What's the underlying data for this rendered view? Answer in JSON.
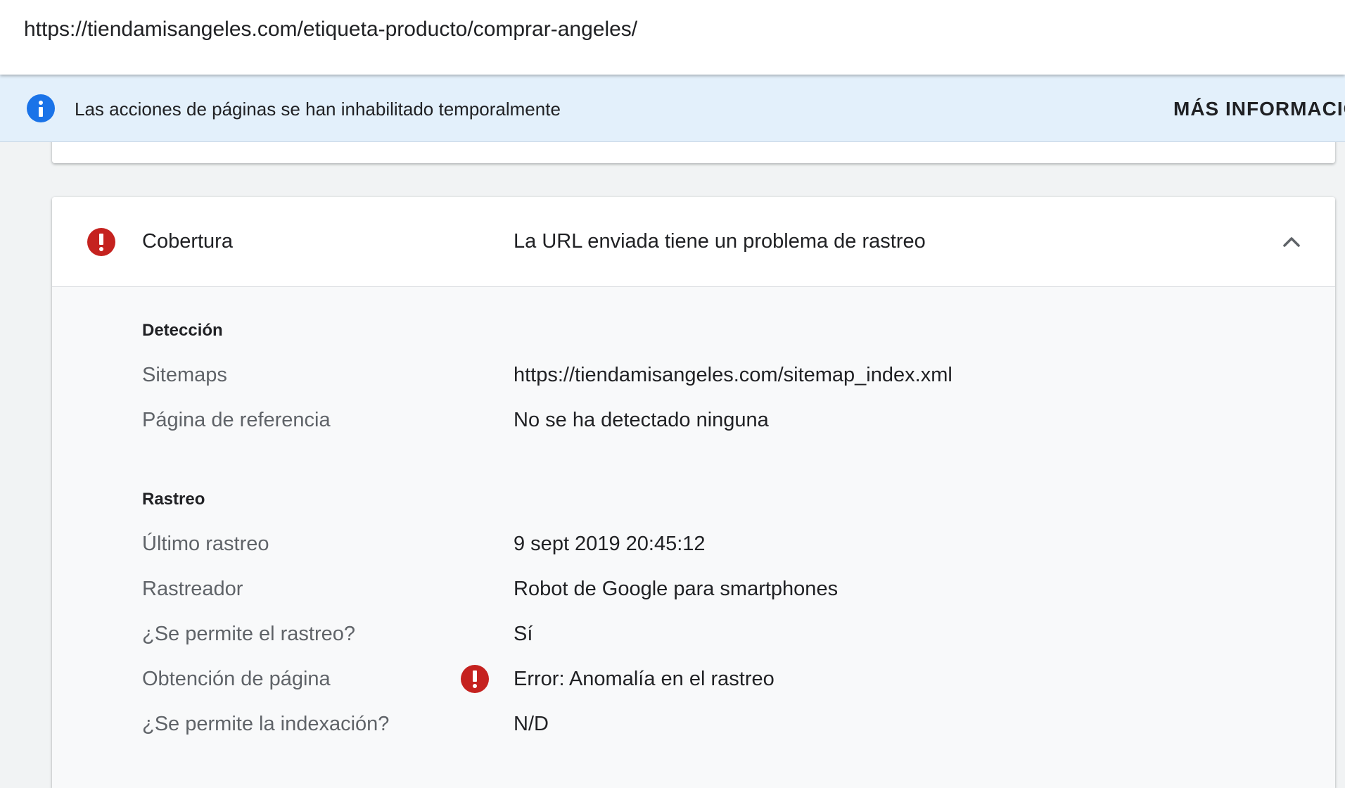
{
  "url_bar": {
    "url": "https://tiendamisangeles.com/etiqueta-producto/comprar-angeles/"
  },
  "banner": {
    "icon": "info-icon",
    "message": "Las acciones de páginas se han inhabilitado temporalmente",
    "link_label": "MÁS INFORMACIÓN"
  },
  "coverage": {
    "status_icon": "error-icon",
    "label": "Cobertura",
    "status": "La URL enviada tiene un problema de rastreo",
    "expanded": true,
    "sections": {
      "detection": {
        "title": "Detección",
        "rows": [
          {
            "label": "Sitemaps",
            "value": "https://tiendamisangeles.com/sitemap_index.xml"
          },
          {
            "label": "Página de referencia",
            "value": "No se ha detectado ninguna"
          }
        ]
      },
      "crawl": {
        "title": "Rastreo",
        "rows": [
          {
            "label": "Último rastreo",
            "value": "9 sept 2019 20:45:12"
          },
          {
            "label": "Rastreador",
            "value": "Robot de Google para smartphones"
          },
          {
            "label": "¿Se permite el rastreo?",
            "value": "Sí"
          },
          {
            "label": "Obtención de página",
            "value": "Error: Anomalía en el rastreo",
            "icon": "error-icon"
          },
          {
            "label": "¿Se permite la indexación?",
            "value": "N/D"
          }
        ]
      }
    }
  },
  "colors": {
    "error": "#c5221f",
    "info": "#1a73e8",
    "banner_bg": "#e3f0fb"
  }
}
